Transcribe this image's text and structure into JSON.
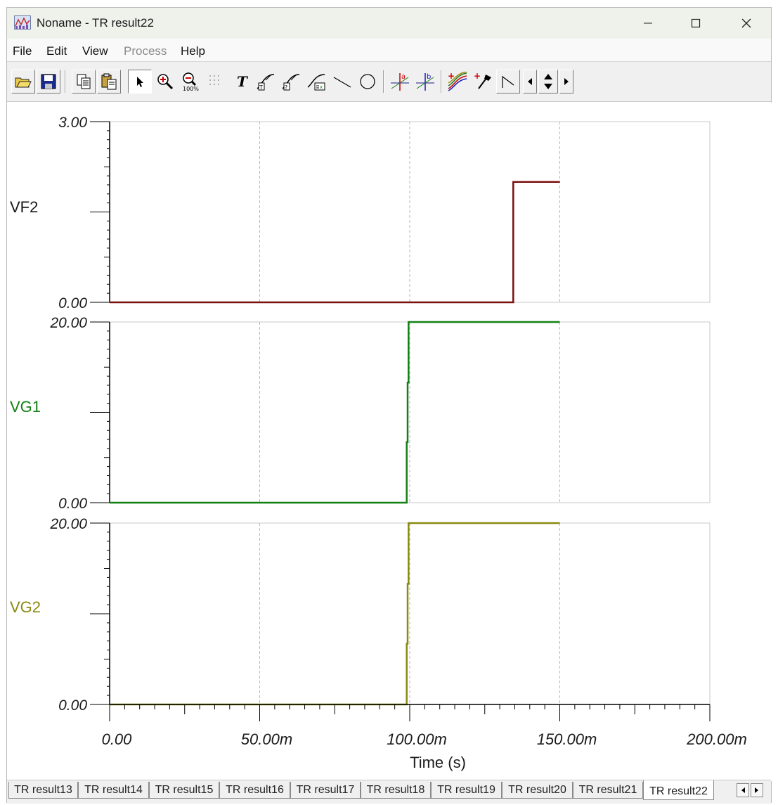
{
  "window": {
    "title": "Noname - TR result22"
  },
  "menu": {
    "items": [
      {
        "label": "File",
        "enabled": true
      },
      {
        "label": "Edit",
        "enabled": true
      },
      {
        "label": "View",
        "enabled": true
      },
      {
        "label": "Process",
        "enabled": false
      },
      {
        "label": "Help",
        "enabled": true
      }
    ]
  },
  "toolbar": {
    "buttons": [
      {
        "name": "open-icon"
      },
      {
        "name": "save-icon"
      },
      {
        "name": "copy-icon"
      },
      {
        "name": "paste-icon"
      },
      {
        "name": "select-arrow-icon",
        "pressed": true
      },
      {
        "name": "zoom-in-icon"
      },
      {
        "name": "zoom-100-icon"
      },
      {
        "name": "grid-icon",
        "enabled": false
      },
      {
        "name": "text-icon"
      },
      {
        "name": "curve-label-icon"
      },
      {
        "name": "curve-info-icon"
      },
      {
        "name": "curve-formula-icon"
      },
      {
        "name": "line-icon"
      },
      {
        "name": "circle-icon"
      },
      {
        "name": "cursor-a-icon"
      },
      {
        "name": "cursor-b-icon"
      },
      {
        "name": "add-curve-icon"
      },
      {
        "name": "add-probe-icon"
      },
      {
        "name": "bode-marker-icon"
      },
      {
        "name": "cursor-move-left-icon"
      },
      {
        "name": "cursor-move-updown-icon"
      },
      {
        "name": "cursor-move-right-icon"
      }
    ]
  },
  "chart_data": {
    "type": "line",
    "xlabel": "Time (s)",
    "xlim": [
      0,
      0.2
    ],
    "x_ticks": [
      "0.00",
      "50.00m",
      "100.00m",
      "150.00m",
      "200.00m"
    ],
    "grid": "vertical dashed",
    "panels": [
      {
        "name": "VF2",
        "color": "#7b1010",
        "ylim": [
          0,
          3
        ],
        "y_ticks": [
          "0.00",
          "3.00"
        ],
        "x": [
          0,
          0.1345,
          0.1345,
          0.15
        ],
        "y": [
          0,
          0,
          2,
          2
        ]
      },
      {
        "name": "VG1",
        "color": "#128012",
        "ylim": [
          0,
          20
        ],
        "y_ticks": [
          "0.00",
          "20.00"
        ],
        "x": [
          0,
          0.099,
          0.099,
          0.0993,
          0.0993,
          0.0996,
          0.0996,
          0.15
        ],
        "y": [
          0,
          0,
          6.7,
          6.7,
          13.3,
          13.3,
          20,
          20
        ]
      },
      {
        "name": "VG2",
        "color": "#8a8a12",
        "ylim": [
          0,
          20
        ],
        "y_ticks": [
          "0.00",
          "20.00"
        ],
        "x": [
          0,
          0.099,
          0.099,
          0.0993,
          0.0993,
          0.0996,
          0.0996,
          0.15
        ],
        "y": [
          0,
          0,
          6.7,
          6.7,
          13.3,
          13.3,
          20,
          20
        ]
      }
    ]
  },
  "tabs": {
    "items": [
      "TR result13",
      "TR result14",
      "TR result15",
      "TR result16",
      "TR result17",
      "TR result18",
      "TR result19",
      "TR result20",
      "TR result21",
      "TR result22"
    ],
    "active": "TR result22"
  }
}
